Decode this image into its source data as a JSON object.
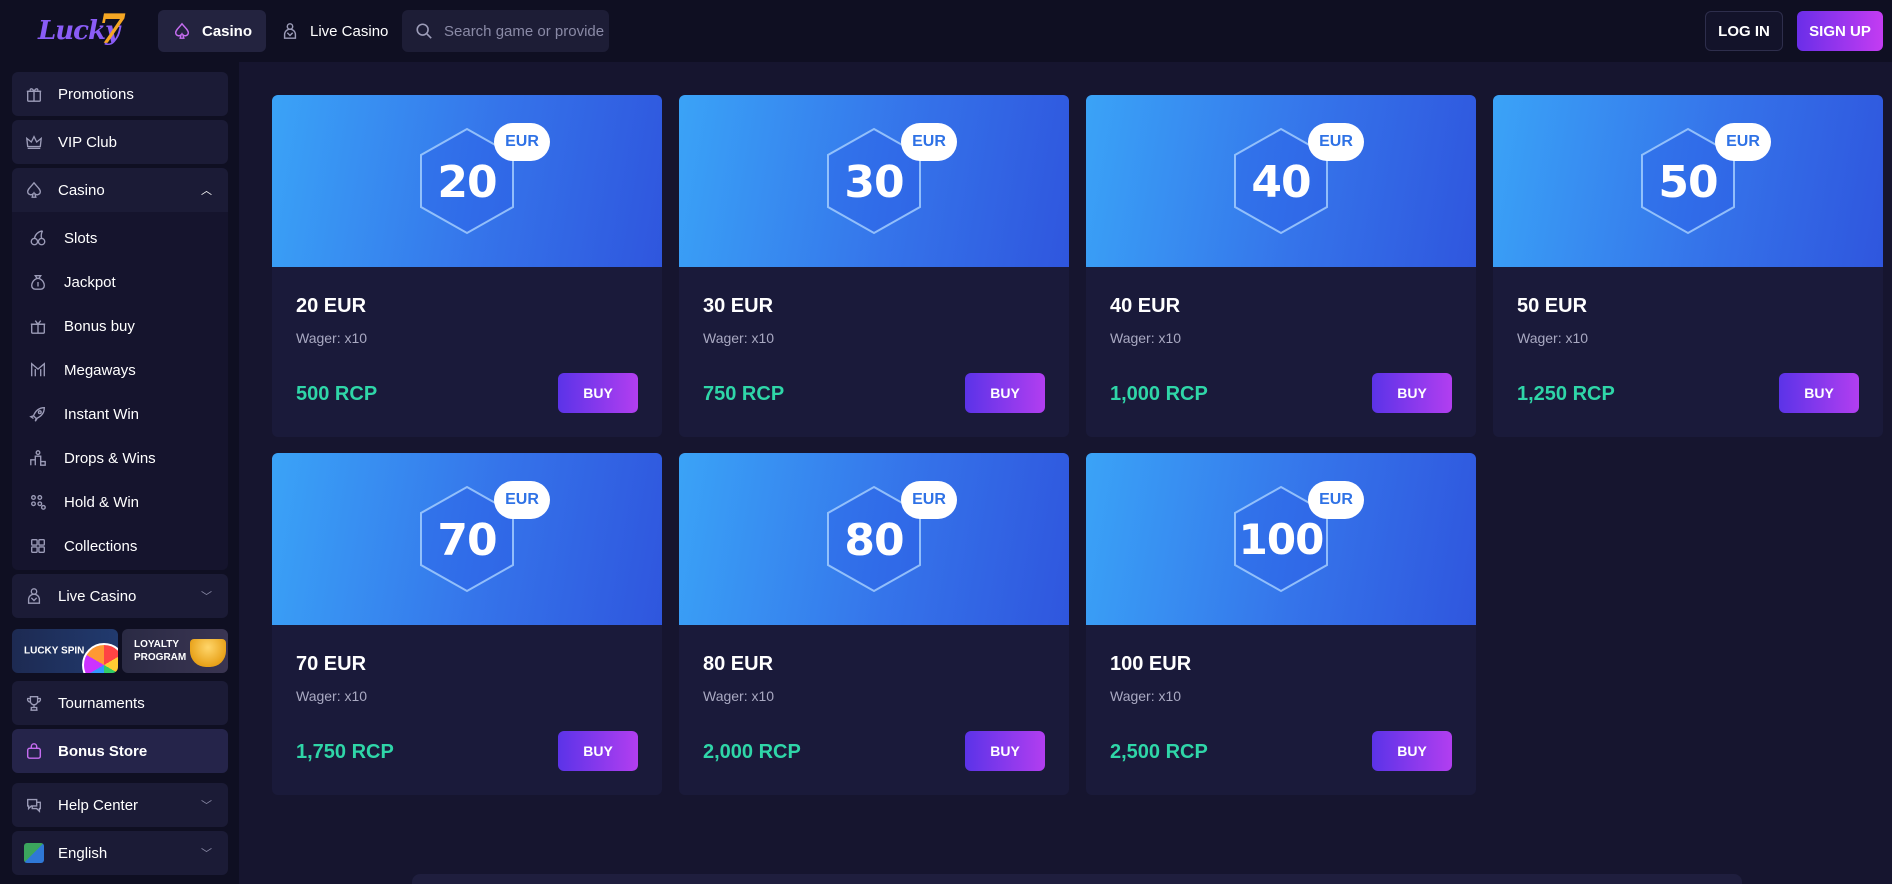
{
  "header": {
    "logo_text": "Lucky",
    "logo_seven": "7",
    "tabs": [
      {
        "label": "Casino",
        "icon": "spade-icon"
      },
      {
        "label": "Live Casino",
        "icon": "dealer-icon"
      }
    ],
    "search_placeholder": "Search game or provider",
    "login_label": "LOG IN",
    "signup_label": "SIGN UP"
  },
  "sidebar": {
    "items": [
      {
        "label": "Promotions",
        "icon": "gift-icon"
      },
      {
        "label": "VIP Club",
        "icon": "crown-icon"
      },
      {
        "label": "Casino",
        "icon": "spade-icon"
      },
      {
        "label": "Live Casino",
        "icon": "dealer-icon"
      },
      {
        "label": "Tournaments",
        "icon": "trophy-icon"
      },
      {
        "label": "Bonus Store",
        "icon": "bag-icon"
      },
      {
        "label": "Help Center",
        "icon": "chat-icon"
      },
      {
        "label": "English",
        "icon": "flag-icon"
      }
    ],
    "casino_sub": [
      {
        "label": "Slots",
        "icon": "cherries-icon"
      },
      {
        "label": "Jackpot",
        "icon": "money-bag-icon"
      },
      {
        "label": "Bonus buy",
        "icon": "gift-box-icon"
      },
      {
        "label": "Megaways",
        "icon": "megaways-icon"
      },
      {
        "label": "Instant Win",
        "icon": "rocket-icon"
      },
      {
        "label": "Drops & Wins",
        "icon": "podium-icon"
      },
      {
        "label": "Hold & Win",
        "icon": "dots-grid-icon"
      },
      {
        "label": "Collections",
        "icon": "collection-grid-icon"
      }
    ],
    "banners": {
      "lucky_spin": "LUCKY SPIN",
      "loyalty_line1": "LOYALTY",
      "loyalty_line2": "PROGRAM"
    }
  },
  "store": {
    "currency_badge": "EUR",
    "buy_label": "BUY",
    "cards": [
      {
        "amount": "20",
        "title": "20 EUR",
        "wager": "Wager: x10",
        "price": "500 RCP"
      },
      {
        "amount": "30",
        "title": "30 EUR",
        "wager": "Wager: x10",
        "price": "750 RCP"
      },
      {
        "amount": "40",
        "title": "40 EUR",
        "wager": "Wager: x10",
        "price": "1,000 RCP"
      },
      {
        "amount": "50",
        "title": "50 EUR",
        "wager": "Wager: x10",
        "price": "1,250 RCP"
      },
      {
        "amount": "70",
        "title": "70 EUR",
        "wager": "Wager: x10",
        "price": "1,750 RCP"
      },
      {
        "amount": "80",
        "title": "80 EUR",
        "wager": "Wager: x10",
        "price": "2,000 RCP"
      },
      {
        "amount": "100",
        "title": "100 EUR",
        "wager": "Wager: x10",
        "price": "2,500 RCP"
      }
    ]
  },
  "colors": {
    "background": "#16152f",
    "panel": "#0f0f22",
    "card": "#1a1a3a",
    "accent_purple": "#6a2ee8",
    "accent_magenta": "#c43cf2",
    "price_green": "#2fd6a8",
    "card_blue": "#3574ea"
  }
}
